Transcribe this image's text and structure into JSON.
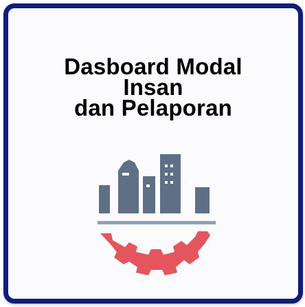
{
  "tile": {
    "title_lines": [
      "Dasboard Modal",
      "Insan",
      "dan Pelaporan"
    ],
    "icon": "city-gear-icon",
    "colors": {
      "border": "#0f1d7a",
      "buildings": "#5f6f86",
      "gear": "#e4555d",
      "base_line": "#8fa3b8",
      "windows": "#ffffff"
    }
  }
}
